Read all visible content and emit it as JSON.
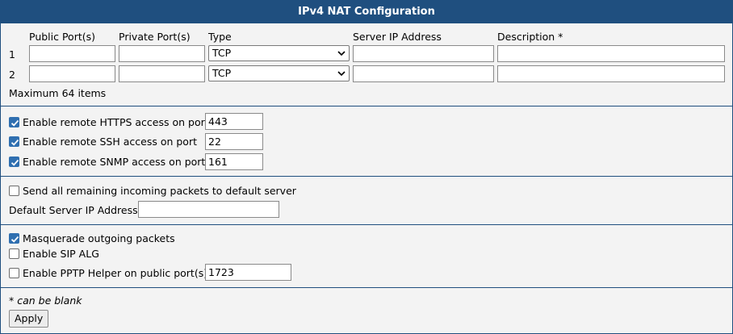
{
  "title": "IPv4 NAT Configuration",
  "table": {
    "headers": [
      "Public Port(s)",
      "Private Port(s)",
      "Type",
      "Server IP Address",
      "Description *"
    ],
    "rows": [
      {
        "index": "1",
        "public": "",
        "private": "",
        "type": "TCP",
        "server_ip": "",
        "description": ""
      },
      {
        "index": "2",
        "public": "",
        "private": "",
        "type": "TCP",
        "server_ip": "",
        "description": ""
      }
    ],
    "max_note": "Maximum 64 items"
  },
  "remote_access": {
    "https": {
      "label": "Enable remote HTTPS access on port",
      "checked": true,
      "port": "443"
    },
    "ssh": {
      "label": "Enable remote SSH access on port",
      "checked": true,
      "port": "22"
    },
    "snmp": {
      "label": "Enable remote SNMP access on port",
      "checked": true,
      "port": "161"
    }
  },
  "default_server": {
    "send_label": "Send all remaining incoming packets to default server",
    "send_checked": false,
    "ip_label": "Default Server IP Address",
    "ip_value": ""
  },
  "misc": {
    "masquerade_label": "Masquerade outgoing packets",
    "masquerade_checked": true,
    "sip_label": "Enable SIP ALG",
    "sip_checked": false,
    "pptp_label": "Enable PPTP Helper on public port(s)",
    "pptp_checked": false,
    "pptp_port": "1723"
  },
  "footer": {
    "note": "* can be blank",
    "apply_label": "Apply"
  },
  "colors": {
    "accent": "#1f4f7f",
    "checkbox": "#2f6fb0",
    "panel": "#f3f3f3"
  }
}
